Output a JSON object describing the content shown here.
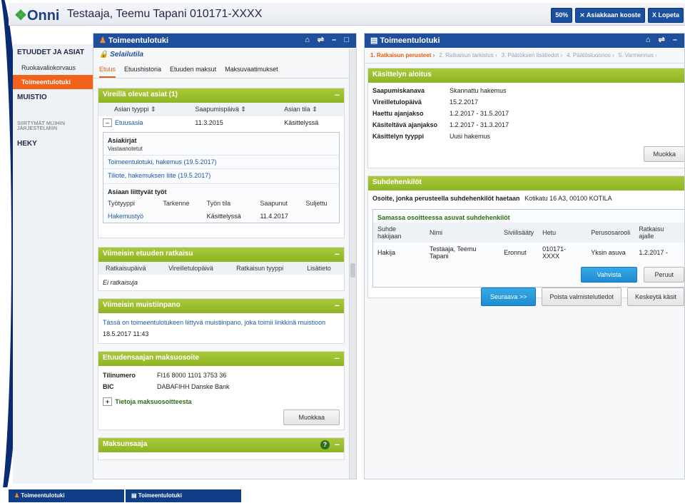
{
  "header": {
    "logo": "Onni",
    "customer": "Testaaja, Teemu Tapani 010171-XXXX",
    "zoom": "50%",
    "summary_button": "Asiakkaan kooste",
    "exit_button": "Lopeta"
  },
  "sidebar": {
    "heading1": "ETUUDET JA ASIAT",
    "items": [
      "Ruokavaliokorvaus",
      "Toimeentulotuki"
    ],
    "heading2": "MUISTIO",
    "moved_label": "SIIRTYMÄT MUIHIN JÄRJESTELMIIN",
    "heading3": "HEKY"
  },
  "left_panel": {
    "title": "Toimeentulotuki",
    "subtitle": "Selailutila",
    "tabs": [
      "Etuus",
      "Etuushistoria",
      "Etuuden maksut",
      "Maksuvaatimukset"
    ],
    "pending": {
      "title": "Vireillä olevat asiat (1)",
      "columns": [
        "Asian tyyppi",
        "Saapumispäivä",
        "Asian tila"
      ],
      "row": {
        "type": "Etuusasia",
        "date": "11.3.2015",
        "status": "Käsittelyssä"
      },
      "documents_title": "Asiakirjat",
      "received_label": "Vastaanotetut",
      "documents": [
        "Toimeentulotuki, hakemus (19.5.2017)",
        "Tiliote, hakemuksen liite (19.5.2017)"
      ],
      "tasks_title": "Asiaan liittyvät työt",
      "task_columns": [
        "Työtyyppi",
        "Tarkenne",
        "Työn tila",
        "Saapunut",
        "Suljettu"
      ],
      "task_row": {
        "type": "Hakemustyö",
        "spec": "",
        "state": "Käsittelyssä",
        "arrived": "11.4.2017",
        "closed": ""
      }
    },
    "latest_decision": {
      "title": "Viimeisin etuuden ratkaisu",
      "columns": [
        "Ratkaisupäivä",
        "Vireilletulopäivä",
        "Ratkaisun tyyppi",
        "Lisätieto"
      ],
      "empty": "Ei ratkaisuja"
    },
    "latest_note": {
      "title": "Viimeisin muistiinpano",
      "text": "Tässä on toimeentulotukeen liittyvä muistiinpano, joka toimii linkkinä muistioon",
      "time": "18.5.2017 11:43"
    },
    "payment_address": {
      "title": "Etuudensaajan maksuosoite",
      "account_label": "Tilinumero",
      "account": "FI16 8000 1101 3753 36",
      "bic_label": "BIC",
      "bic": "DABAFIHH Danske Bank",
      "more": "Tietoja maksuosoitteesta",
      "edit_button": "Muokkaa"
    },
    "payee": {
      "title": "Maksunsaaja",
      "help": "?"
    }
  },
  "right_panel": {
    "title": "Toimeentulotuki",
    "steps": [
      "1. Ratkaisun perusteet ›",
      "2. Ratkaisun tarkistus ›",
      "3. Päätöksen lisätiedot ›",
      "4. Päätösluonnos ›",
      "5. Varmennus ›"
    ],
    "start": {
      "title": "Käsittelyn aloitus",
      "rows": [
        {
          "k": "Saapumiskanava",
          "v": "Skannattu hakemus"
        },
        {
          "k": "Vireilletulopäivä",
          "v": "15.2.2017"
        },
        {
          "k": "Haettu ajanjakso",
          "v": "1.2.2017 - 31.5.2017"
        },
        {
          "k": "Käsiteltävä ajanjakso",
          "v": "1.2.2017 - 31.3.2017"
        },
        {
          "k": "Käsittelyn tyyppi",
          "v": "Uusi hakemus"
        }
      ],
      "edit_button": "Muokka"
    },
    "relations": {
      "title": "Suhdehenkilöt",
      "address_label": "Osoite, jonka perusteella suhdehenkilöt haetaan",
      "address": "Kotikatu 16 A3, 00100 KOTILA",
      "same_address_title": "Samassa osoitteessa asuvat suhdehenkilöt",
      "columns": [
        "Suhde hakijaan",
        "Nimi",
        "Siviilisääty",
        "Hetu",
        "Perusosarooli",
        "Ratkaisu ajalle"
      ],
      "row": {
        "relation": "Hakija",
        "name": "Testaaja, Teemu Tapani",
        "status": "Eronnut",
        "id": "010171-XXXX",
        "role": "Yksin asuva",
        "period": "1.2.2017 -"
      },
      "confirm_button": "Vahvista",
      "cancel_button": "Peruut"
    },
    "actions": {
      "next": "Seuraava >>",
      "remove": "Poista valmistelutiedot",
      "stop": "Keskeytä käsit"
    }
  },
  "taskbar": {
    "tasks": [
      "Toimeentulotuki",
      "Toimeentulotuki"
    ]
  }
}
